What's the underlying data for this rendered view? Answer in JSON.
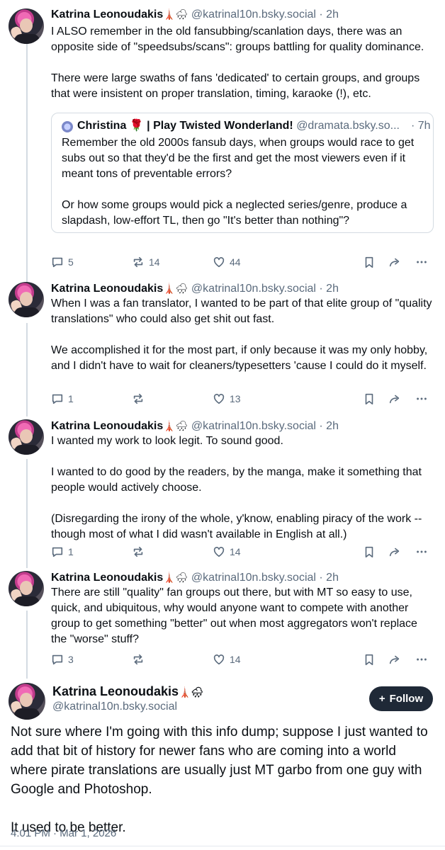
{
  "posts": [
    {
      "name": "Katrina Leonoudakis",
      "emoji": "🗼🌧",
      "handle": "@katrinal10n.bsky.social",
      "time": "· 2h",
      "paragraphs": [
        "I ALSO remember in the old fansubbing/scanlation days, there was an opposite side of \"speedsubs/scans\": groups battling for quality dominance.",
        "There were large swaths of fans 'dedicated' to certain groups, and groups that were insistent on proper translation, timing, karaoke (!), etc."
      ],
      "quote": {
        "name": "Christina 🌹 | Play Twisted Wonderland!",
        "handle": "@dramata.bsky.so...",
        "time": "· 7h",
        "paragraphs": [
          "Remember the old 2000s fansub days, when groups would race to get subs out so that they'd be the first and get the most viewers even if it meant tons of preventable errors?",
          "Or how some groups would pick a neglected series/genre, produce a slapdash, low-effort TL, then go \"It's better than nothing\"?"
        ]
      },
      "replies": "5",
      "reposts": "14",
      "likes": "44"
    },
    {
      "name": "Katrina Leonoudakis",
      "emoji": "🗼🌧",
      "handle": "@katrinal10n.bsky.social",
      "time": "· 2h",
      "paragraphs": [
        "When I was a fan translator, I wanted to be part of that elite group of \"quality translations\" who could also get shit out fast.",
        "We accomplished it for the most part, if only because it was my only hobby, and I didn't have to wait for cleaners/typesetters 'cause I could do it myself."
      ],
      "replies": "1",
      "reposts": "",
      "likes": "13"
    },
    {
      "name": "Katrina Leonoudakis",
      "emoji": "🗼🌧",
      "handle": "@katrinal10n.bsky.social",
      "time": "· 2h",
      "paragraphs": [
        "I wanted my work to look legit. To sound good.",
        "I wanted to do good by the readers, by the manga, make it something that people would actively choose.",
        "(Disregarding the irony of the whole, y'know, enabling piracy of the work -- though most of what I did wasn't available in English at all.)"
      ],
      "replies": "1",
      "reposts": "",
      "likes": "14"
    },
    {
      "name": "Katrina Leonoudakis",
      "emoji": "🗼🌧",
      "handle": "@katrinal10n.bsky.social",
      "time": "· 2h",
      "paragraphs": [
        "There are still \"quality\" fan groups out there, but with MT so easy to use, quick, and ubiquitous, why would anyone want to compete with another group to get something \"better\" out when most aggregators won't replace the \"worse\" stuff?"
      ],
      "replies": "3",
      "reposts": "",
      "likes": "14"
    }
  ],
  "main": {
    "name": "Katrina Leonoudakis",
    "emoji": "🗼🌧",
    "handle": "@katrinal10n.bsky.social",
    "follow_label": "Follow",
    "follow_icon": "+",
    "paragraphs": [
      "Not sure where I'm going with this info dump; suppose I just wanted to add that bit of history for newer fans who are coming into a world where pirate translations are usually just MT garbo from one guy with Google and Photoshop.",
      "It used to be better."
    ],
    "timestamp": "4:01 PM · Mar 1, 2026"
  },
  "icons": {
    "reply": "reply-icon",
    "repost": "repost-icon",
    "like": "heart-icon",
    "bookmark": "bookmark-icon",
    "share": "share-icon",
    "more": "more-icon"
  },
  "colors": {
    "text": "#0b0f14",
    "muted": "#5b6b7d",
    "border": "#d4dbe2",
    "follow_bg": "#1f2937"
  }
}
